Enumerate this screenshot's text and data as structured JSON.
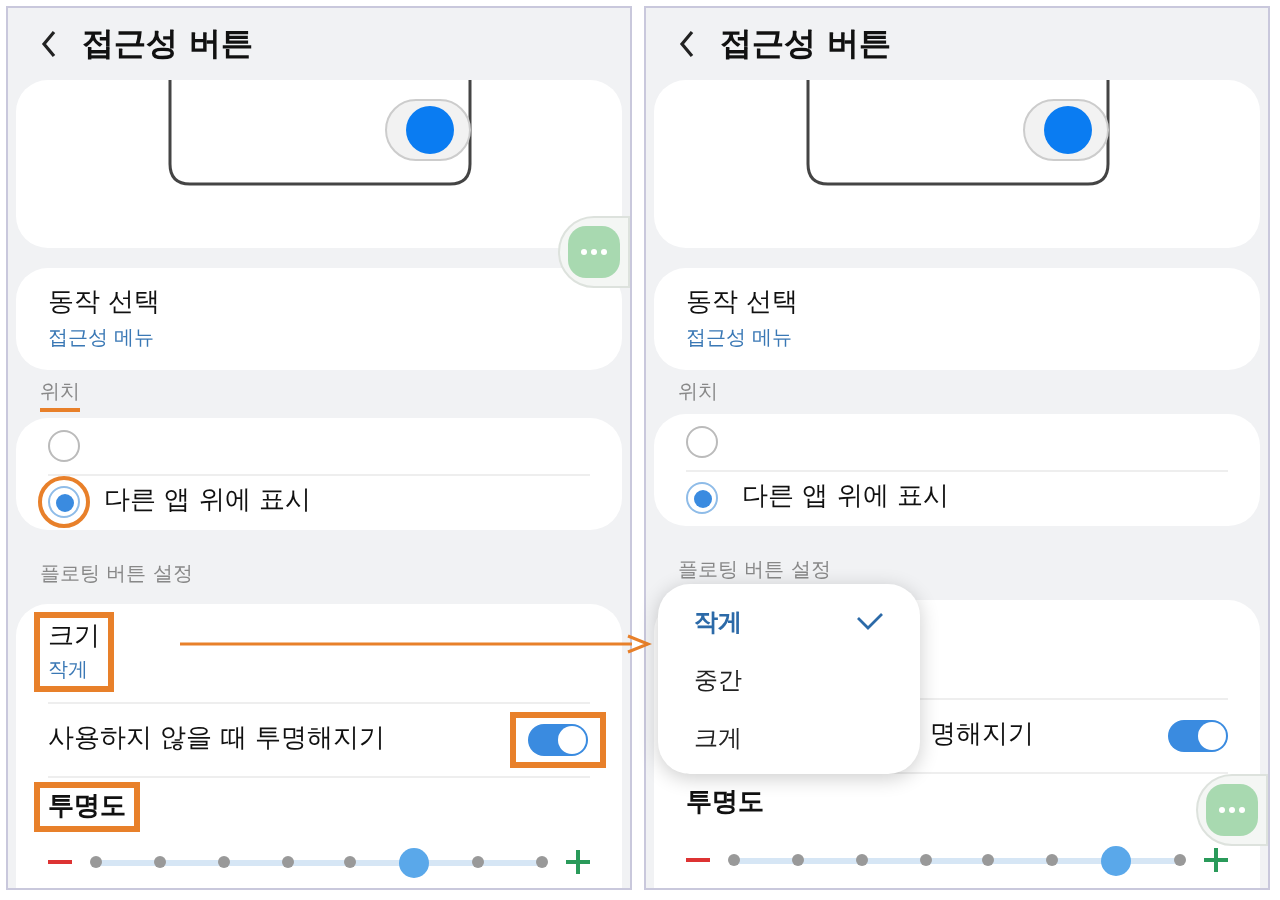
{
  "panels": [
    {
      "title": "접근성 버튼",
      "annotated": true,
      "action": {
        "label": "동작 선택",
        "value": "접근성 메뉴"
      },
      "position_label": "위치",
      "position_options": [
        {
          "selected": false
        },
        {
          "label": "다른 앱 위에 표시",
          "selected": true
        }
      ],
      "floating_label": "플로팅 버튼 설정",
      "size": {
        "label": "크기",
        "value": "작게"
      },
      "transparent_toggle": {
        "label": "사용하지 않을 때 투명해지기",
        "on": true
      },
      "opacity": {
        "label": "투명도",
        "level": 0.714
      },
      "fab_low": false
    },
    {
      "title": "접근성 버튼",
      "annotated": false,
      "action": {
        "label": "동작 선택",
        "value": "접근성 메뉴"
      },
      "position_label": "위치",
      "position_options": [
        {
          "selected": false
        },
        {
          "label": "다른 앱 위에 표시",
          "selected": true
        }
      ],
      "floating_label": "플로팅 버튼 설정",
      "transparent_toggle": {
        "label": "명해지기",
        "on": true,
        "partly_hidden": true
      },
      "opacity": {
        "label": "투명도",
        "level": 0.857
      },
      "menu": [
        {
          "label": "작게",
          "selected": true
        },
        {
          "label": "중간",
          "selected": false
        },
        {
          "label": "크게",
          "selected": false
        }
      ],
      "fab_low": true
    }
  ]
}
